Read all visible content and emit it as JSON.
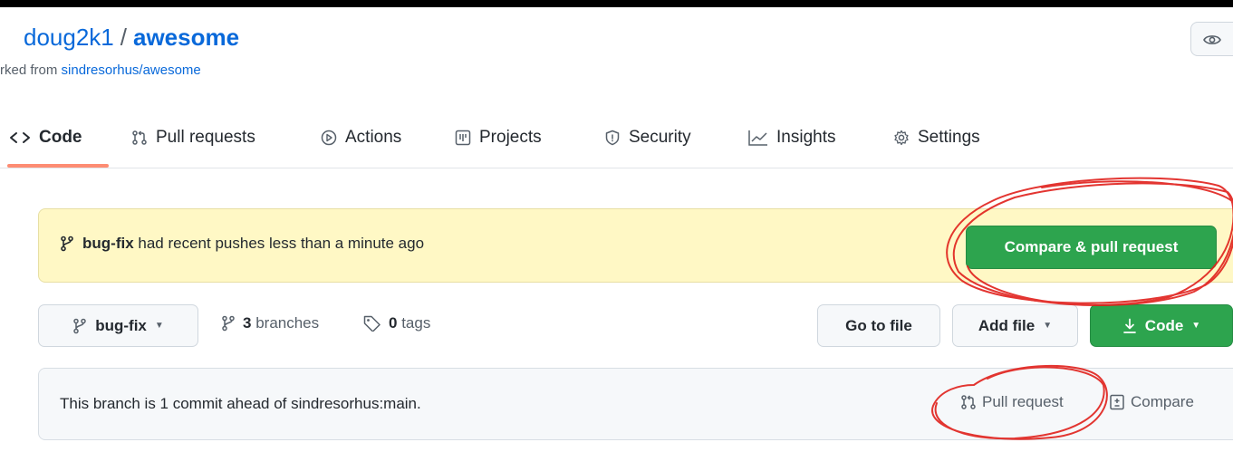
{
  "repo": {
    "owner": "doug2k1",
    "separator": "/",
    "name": "awesome",
    "forked_prefix": "rked from",
    "forked_from": "sindresorhus/awesome"
  },
  "tabs": [
    {
      "label": "Code",
      "icon": "code-icon",
      "active": true
    },
    {
      "label": "Pull requests",
      "icon": "git-pull-request-icon"
    },
    {
      "label": "Actions",
      "icon": "play-icon"
    },
    {
      "label": "Projects",
      "icon": "project-icon"
    },
    {
      "label": "Security",
      "icon": "shield-icon"
    },
    {
      "label": "Insights",
      "icon": "graph-icon"
    },
    {
      "label": "Settings",
      "icon": "gear-icon"
    }
  ],
  "banner": {
    "branch": "bug-fix",
    "message": "had recent pushes less than a minute ago",
    "button_label": "Compare & pull request"
  },
  "toolbar": {
    "branch_select": "bug-fix",
    "branches_count": "3",
    "branches_label": "branches",
    "tags_count": "0",
    "tags_label": "tags",
    "go_to_file": "Go to file",
    "add_file": "Add file",
    "code": "Code"
  },
  "ahead": {
    "message": "This branch is 1 commit ahead of sindresorhus:main.",
    "pull_request": "Pull request",
    "compare": "Compare"
  },
  "colors": {
    "link": "#0969da",
    "primary_green": "#2da44e",
    "banner_bg": "#fff8c5",
    "active_tab_underline": "#fd8c73",
    "annotation_red": "#e0201b"
  }
}
